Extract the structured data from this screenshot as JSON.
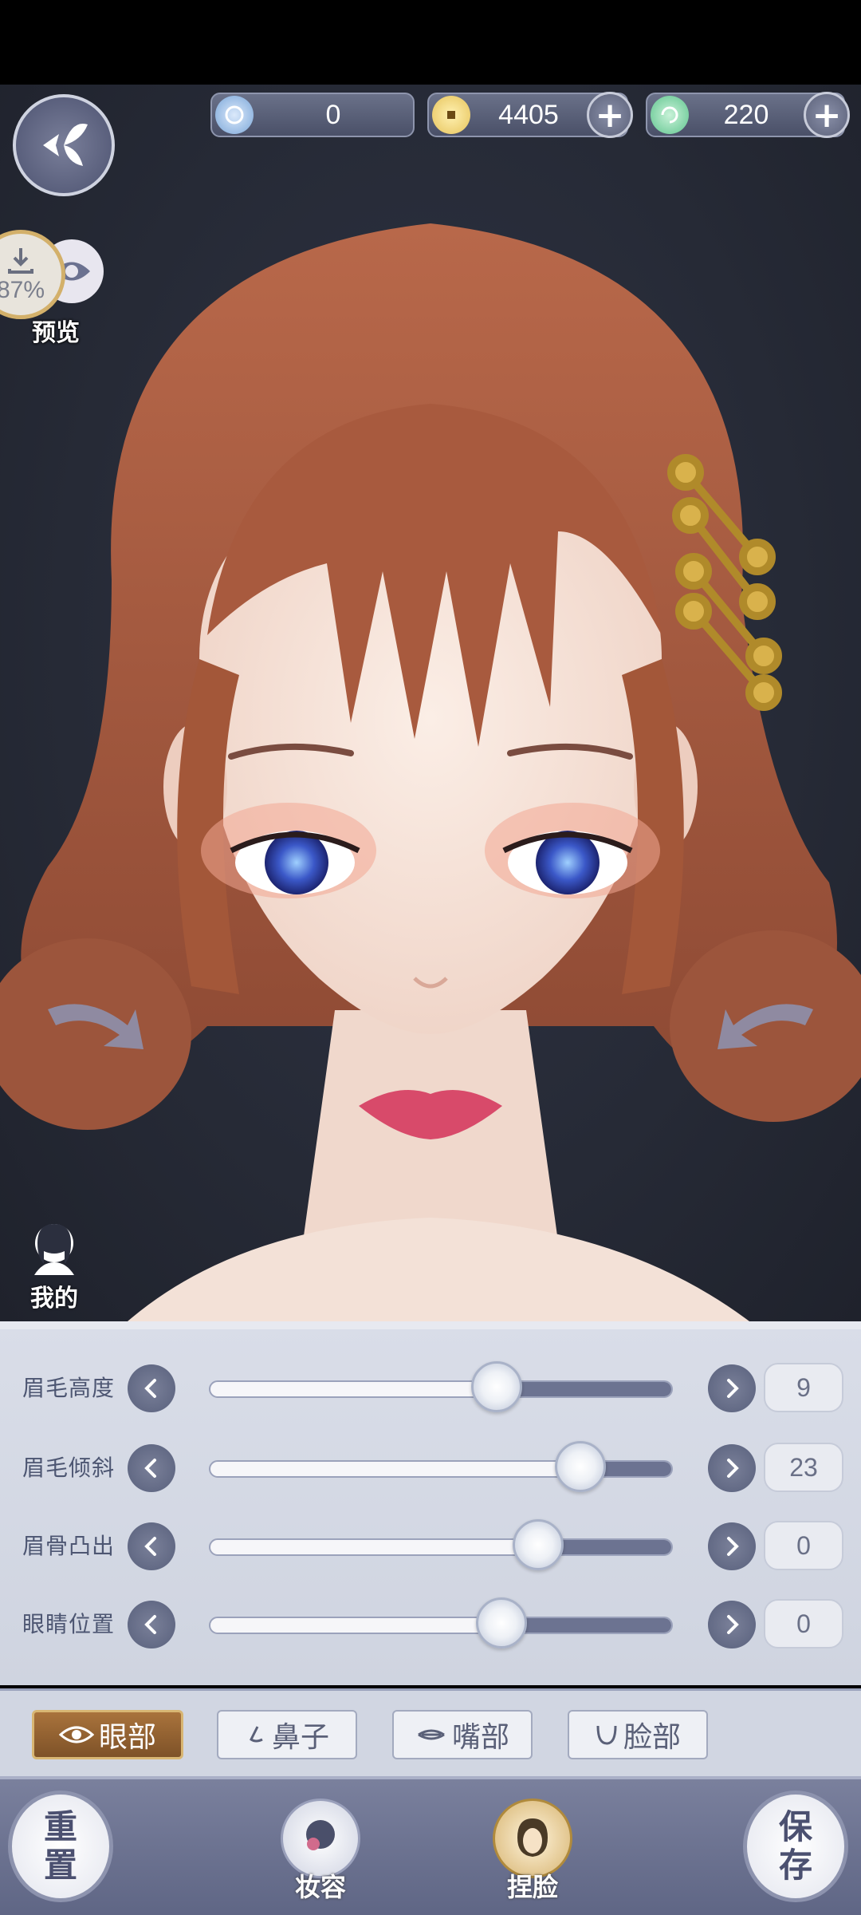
{
  "currencies": [
    {
      "name": "gem",
      "value": "0",
      "has_plus": false,
      "color": "#7aa6d8"
    },
    {
      "name": "coin",
      "value": "4405",
      "has_plus": true,
      "color": "#e6c35a"
    },
    {
      "name": "stamina",
      "value": "220",
      "has_plus": true,
      "color": "#5fc48e"
    }
  ],
  "download": {
    "percent": "87%"
  },
  "preview_label": "预览",
  "my_label": "我的",
  "sliders": [
    {
      "label": "眉毛高度",
      "value": "9",
      "fraction": 0.62
    },
    {
      "label": "眉毛倾斜",
      "value": "23",
      "fraction": 0.8
    },
    {
      "label": "眉骨凸出",
      "value": "0",
      "fraction": 0.71
    },
    {
      "label": "眼睛位置",
      "value": "0",
      "fraction": 0.63
    }
  ],
  "tabs": [
    {
      "label": "眼部",
      "active": true
    },
    {
      "label": "鼻子",
      "active": false
    },
    {
      "label": "嘴部",
      "active": false
    },
    {
      "label": "脸部",
      "active": false
    }
  ],
  "bottom_nav": {
    "reset": "重置",
    "makeup": "妆容",
    "face": "捏脸",
    "save": "保存"
  },
  "colors": {
    "accent": "#a9733c",
    "panel": "#d9dde8",
    "nav": "#6b7190"
  }
}
